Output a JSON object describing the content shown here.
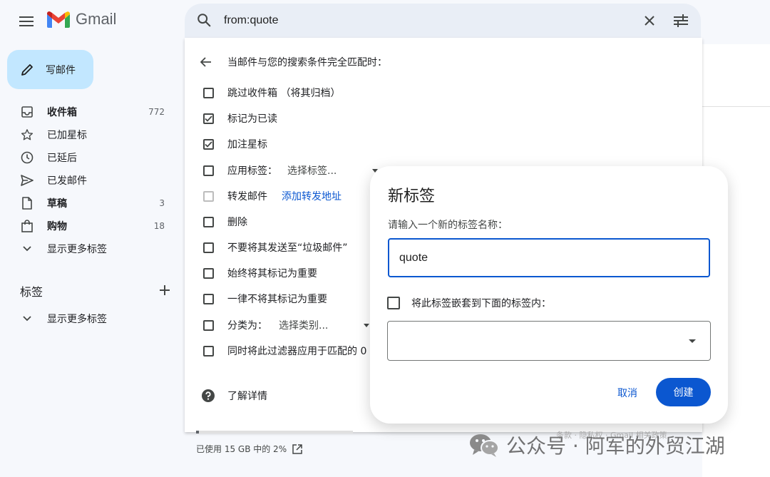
{
  "app": {
    "name": "Gmail"
  },
  "search": {
    "value": "from:quote"
  },
  "compose": {
    "label": "写邮件"
  },
  "nav": {
    "items": [
      {
        "label": "收件箱",
        "count": "772",
        "bold": true,
        "icon": "inbox-icon"
      },
      {
        "label": "已加星标",
        "count": "",
        "bold": false,
        "icon": "star-icon"
      },
      {
        "label": "已延后",
        "count": "",
        "bold": false,
        "icon": "clock-icon"
      },
      {
        "label": "已发邮件",
        "count": "",
        "bold": false,
        "icon": "send-icon"
      },
      {
        "label": "草稿",
        "count": "3",
        "bold": true,
        "icon": "draft-icon"
      },
      {
        "label": "购物",
        "count": "18",
        "bold": true,
        "icon": "shopping-icon"
      },
      {
        "label": "显示更多标签",
        "count": "",
        "bold": false,
        "icon": "chevron-down-icon"
      }
    ]
  },
  "labels": {
    "title": "标签",
    "more": "显示更多标签"
  },
  "filter": {
    "header": "当邮件与您的搜索条件完全匹配时：",
    "options": [
      {
        "label": "跳过收件箱 （将其归档）",
        "checked": false
      },
      {
        "label": "标记为已读",
        "checked": true
      },
      {
        "label": "加注星标",
        "checked": true
      },
      {
        "label": "应用标签：",
        "select": "选择标签...",
        "checked": false
      },
      {
        "label": "转发邮件",
        "link": "添加转发地址",
        "checked": false,
        "disabled": true
      },
      {
        "label": "删除",
        "checked": false
      },
      {
        "label": "不要将其发送至“垃圾邮件”",
        "checked": false
      },
      {
        "label": "始终将其标记为重要",
        "checked": false
      },
      {
        "label": "一律不将其标记为重要",
        "checked": false
      },
      {
        "label": "分类为：",
        "select": "选择类别...",
        "checked": false
      },
      {
        "label": "同时将此过滤器应用于匹配的 0",
        "checked": false
      }
    ],
    "learn_more": "了解详情"
  },
  "storage": {
    "text": "已使用 15 GB 中的 2%",
    "fraction": 0.02
  },
  "footer": {
    "links": "条款 · 隐私权 · Gmail 相关政策"
  },
  "dialog": {
    "title": "新标签",
    "prompt": "请输入一个新的标签名称：",
    "input_value": "quote",
    "nest_label": "将此标签嵌套到下面的标签内：",
    "cancel": "取消",
    "create": "创建"
  },
  "watermark": {
    "text": "公众号 · 阿军的外贸江湖"
  },
  "colors": {
    "accent": "#0b57d0",
    "compose_bg": "#c2e7ff",
    "search_bg": "#e9eef6"
  }
}
